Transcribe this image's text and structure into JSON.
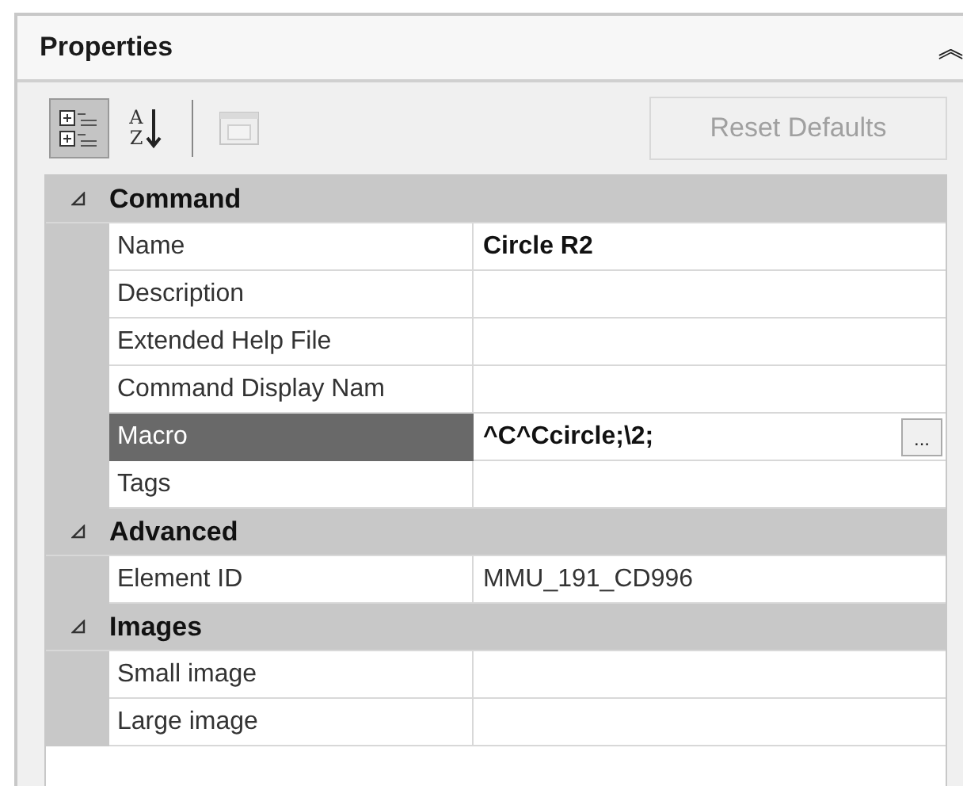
{
  "panel": {
    "title": "Properties",
    "collapse_glyph": "︽"
  },
  "toolbar": {
    "buttons": [
      {
        "kind": "categorized",
        "selected": true,
        "disabled": false
      },
      {
        "kind": "alphabetical",
        "selected": false,
        "disabled": false,
        "letters": [
          "A",
          "Z"
        ]
      },
      {
        "kind": "pages",
        "selected": false,
        "disabled": true
      }
    ],
    "reset_button": {
      "label": "Reset Defaults",
      "disabled": true
    }
  },
  "grid": {
    "categories": [
      {
        "label": "Command",
        "expanded": true,
        "rows": [
          {
            "label": "Name",
            "value": "Circle R2",
            "modified": true,
            "selected": false
          },
          {
            "label": "Description",
            "modified": false,
            "selected": false
          },
          {
            "label": "Extended Help File",
            "modified": false,
            "selected": false
          },
          {
            "label": "Command Display Nam",
            "modified": false,
            "selected": false
          },
          {
            "label": "Macro",
            "value": "^C^Ccircle;\\2;",
            "modified": true,
            "selected": true,
            "button": "..."
          },
          {
            "label": "Tags",
            "modified": false,
            "selected": false
          }
        ]
      },
      {
        "label": "Advanced",
        "expanded": true,
        "rows": [
          {
            "label": "Element ID",
            "value": "MMU_191_CD996",
            "modified": false,
            "selected": false
          }
        ]
      },
      {
        "label": "Images",
        "expanded": true,
        "rows": [
          {
            "label": "Small image",
            "modified": false,
            "selected": false
          },
          {
            "label": "Large image",
            "modified": false,
            "selected": false
          }
        ]
      }
    ]
  }
}
